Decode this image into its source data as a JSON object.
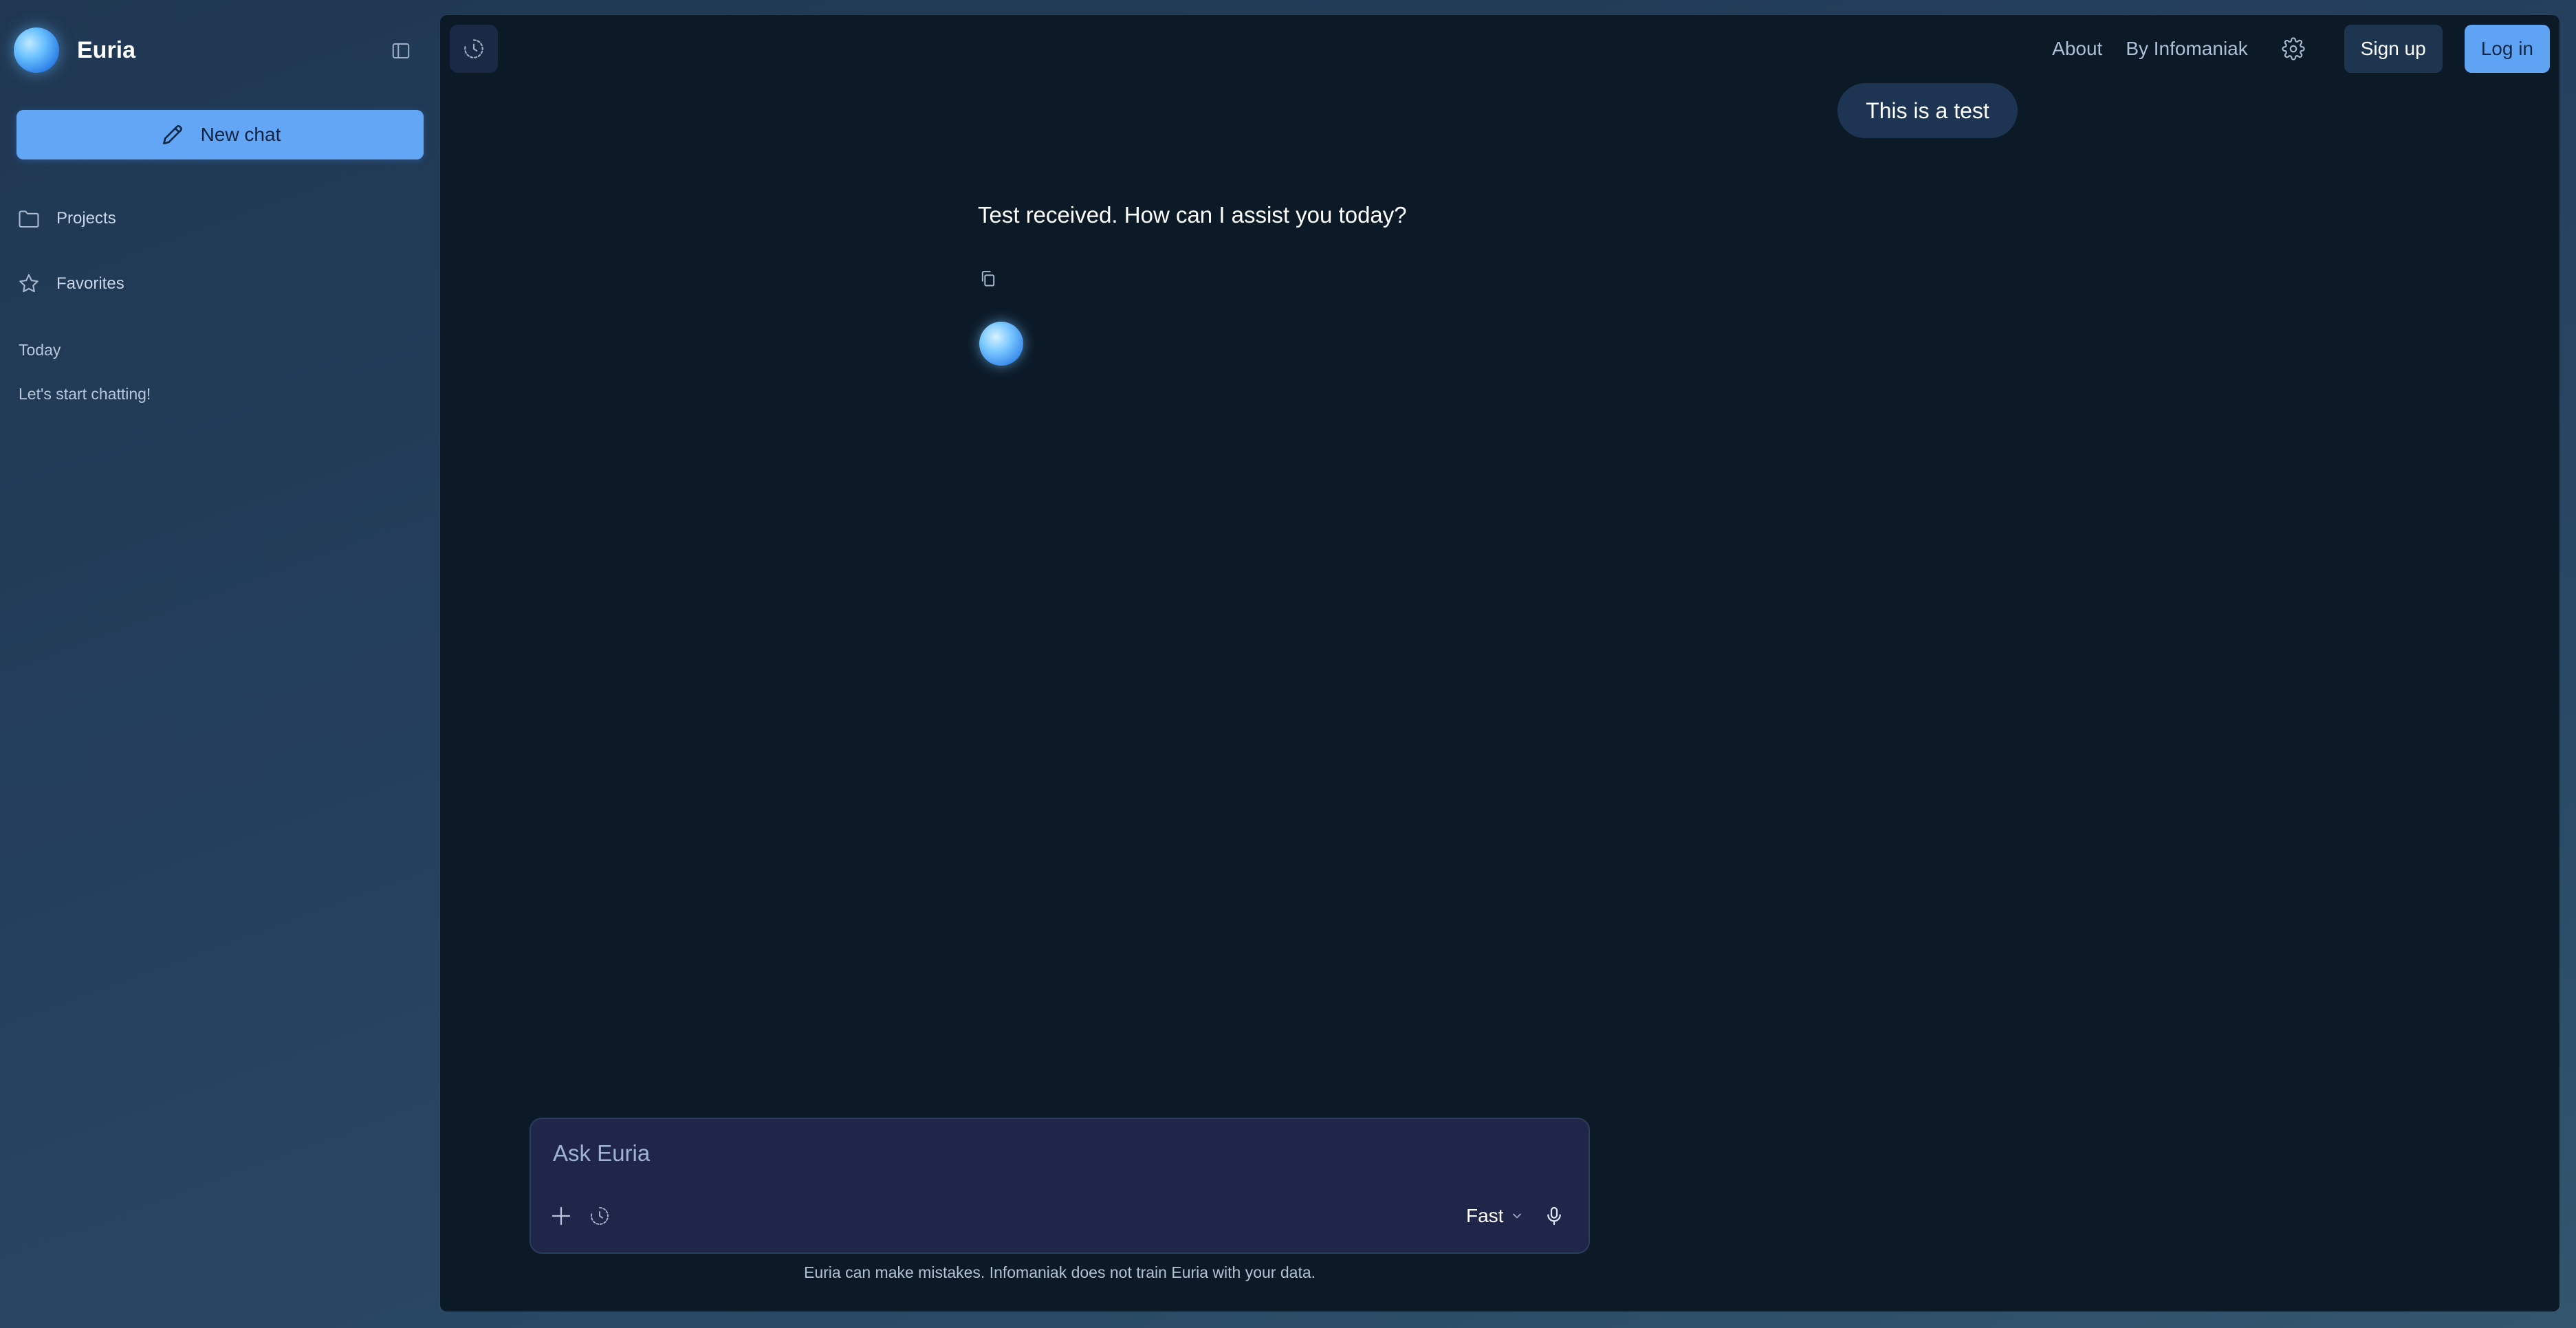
{
  "app": {
    "name": "Euria"
  },
  "sidebar": {
    "new_chat_label": "New chat",
    "items": [
      {
        "label": "Projects",
        "icon": "folder-icon"
      },
      {
        "label": "Favorites",
        "icon": "star-icon"
      }
    ],
    "section_today": "Today",
    "chats": [
      {
        "label": "Let's start chatting!"
      }
    ]
  },
  "header": {
    "about_label": "About",
    "by_label": "By Infomaniak",
    "signup_label": "Sign up",
    "login_label": "Log in"
  },
  "conversation": {
    "user_message": "This is a test",
    "assistant_message": "Test received. How can I assist you today?"
  },
  "composer": {
    "placeholder": "Ask Euria",
    "model": "Fast",
    "disclaimer": "Euria can make mistakes. Infomaniak does not train Euria with your data."
  },
  "colors": {
    "accent": "#63a6f5",
    "panel": "#0c1a28",
    "composer_bg": "#20254a"
  }
}
